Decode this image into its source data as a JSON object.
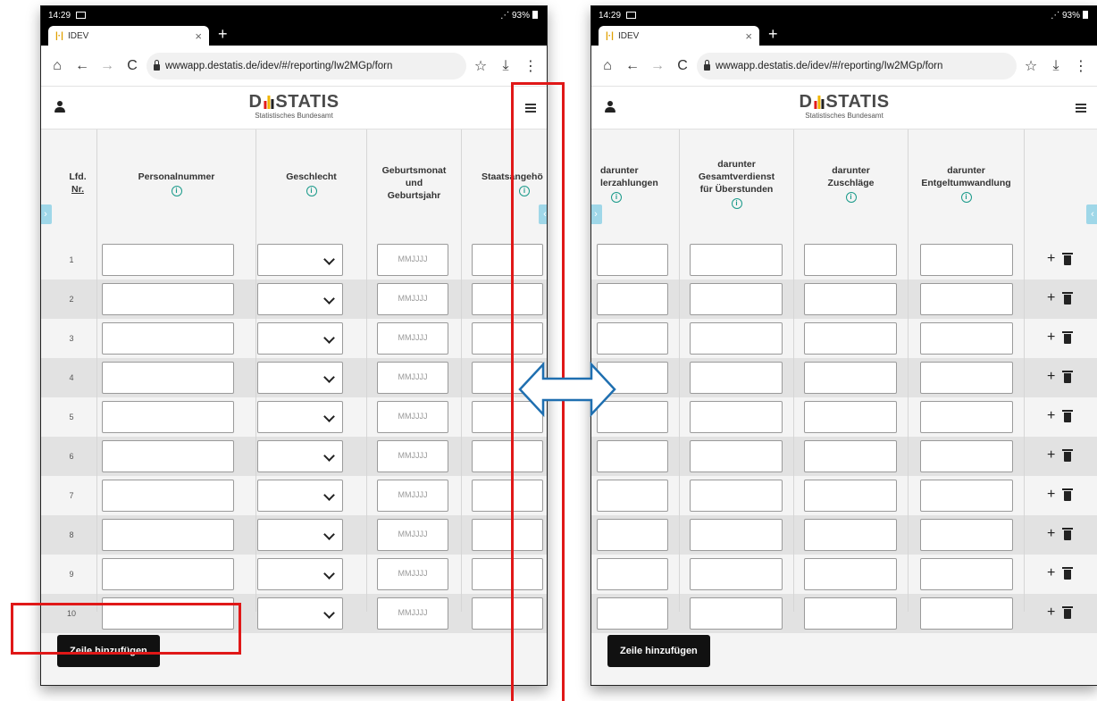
{
  "status": {
    "time": "14:29",
    "battery": "93%"
  },
  "browser": {
    "tab_title": "IDEV",
    "tab_close": "×",
    "new_tab": "+",
    "url": "wwwapp.destatis.de/idev/#/reporting/Iw2MGp/forn",
    "home_icon": "⌂",
    "back_icon": "←",
    "forward_icon": "→",
    "reload_icon": "C",
    "star_icon": "☆",
    "download_icon": "⤓",
    "menu_icon": "⋮"
  },
  "site": {
    "logo_text_a": "D",
    "logo_text_b": "STATIS",
    "logo_sub": "Statistisches Bundesamt",
    "logo_colors": [
      "#e21b1b",
      "#f0b400",
      "#222222"
    ]
  },
  "left_table": {
    "headers": {
      "lfd": [
        "Lfd.",
        "Nr."
      ],
      "personalnummer": "Personalnummer",
      "geschlecht": "Geschlecht",
      "geburt": [
        "Geburtsmonat",
        "und",
        "Geburtsjahr"
      ],
      "staat": "Staatsangehö"
    },
    "date_placeholder": "MMJJJJ",
    "row_numbers": [
      "1",
      "2",
      "3",
      "4",
      "5",
      "6",
      "7",
      "8",
      "9",
      "10"
    ]
  },
  "right_table": {
    "headers": {
      "col1": [
        "darunter",
        "lerzahlungen"
      ],
      "col2": [
        "darunter",
        "Gesamtverdienst",
        "für Überstunden"
      ],
      "col3": [
        "darunter",
        "Zuschläge"
      ],
      "col4": [
        "darunter",
        "Entgeltumwandlung"
      ]
    },
    "add_icon": "+"
  },
  "add_row_label": "Zeile hinzufügen",
  "info_glyph": "i",
  "left_arrow_glyph": "›",
  "right_arrow_glyph": "‹",
  "annotation_colors": {
    "highlight": "#e01818",
    "arrow_stroke": "#1f6fb0"
  }
}
